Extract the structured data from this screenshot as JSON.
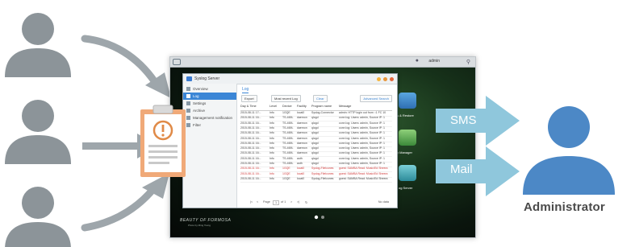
{
  "admin_label": "Administrator",
  "channels": [
    {
      "label": "SMS"
    },
    {
      "label": "Mail"
    }
  ],
  "colors": {
    "user_silhouette": "#8c9499",
    "admin_silhouette": "#4c88c6",
    "arrow_gray": "#9ea6ab",
    "arrow_blue": "#8fc7dc",
    "doc_orange": "#f0a978",
    "accent_blue": "#3b86d6"
  },
  "desktop": {
    "taskbar_user": "admin",
    "window_title": "Syslog Server",
    "sidebar": [
      {
        "label": "Overview",
        "icon": "overview-icon"
      },
      {
        "label": "Log",
        "icon": "log-icon"
      },
      {
        "label": "Settings",
        "icon": "settings-icon"
      },
      {
        "label": "Archive",
        "icon": "archive-icon"
      },
      {
        "label": "Management notification",
        "icon": "notification-icon"
      },
      {
        "label": "Filter",
        "icon": "filter-icon"
      }
    ],
    "tab": "Log",
    "toolbar": {
      "export": "Export",
      "range": "Most recent Log",
      "clear": "Clear",
      "advanced": "Advanced Search"
    },
    "columns": [
      "Day & Time",
      "Level",
      "Device",
      "Facility",
      "Program name",
      "Message"
    ],
    "rows": [
      {
        "time": "2015-08-11 17:..",
        "level": "Info",
        "device": "1GQE",
        "facility": "local0",
        "program": "Syslog-Connector",
        "message": "admin: HTTP login out from ::1 FC 10"
      },
      {
        "time": "2015-08-11 16:..",
        "level": "Info",
        "device": "TS-469L",
        "facility": "daemon",
        "program": "qlogd",
        "message": "conn log: Users: admin, Source IP: 1"
      },
      {
        "time": "2015-08-11 16:..",
        "level": "Info",
        "device": "TS-469L",
        "facility": "daemon",
        "program": "qlogd",
        "message": "conn log: Users: admin, Source IP: 1"
      },
      {
        "time": "2015-08-11 16:..",
        "level": "Info",
        "device": "TS-469L",
        "facility": "daemon",
        "program": "qlogd",
        "message": "conn log: Users: admin, Source IP: 1"
      },
      {
        "time": "2015-08-11 16:..",
        "level": "Info",
        "device": "TS-469L",
        "facility": "daemon",
        "program": "qlogd",
        "message": "conn log: Users: admin, Source IP: 1"
      },
      {
        "time": "2015-08-11 16:..",
        "level": "Info",
        "device": "TS-469L",
        "facility": "daemon",
        "program": "qlogd",
        "message": "conn log: Users: admin, Source IP: 1"
      },
      {
        "time": "2015-08-11 16:..",
        "level": "Info",
        "device": "TS-469L",
        "facility": "daemon",
        "program": "qlogd",
        "message": "conn log: Users: admin, Source IP: 1"
      },
      {
        "time": "2015-08-11 16:..",
        "level": "Info",
        "device": "TS-469L",
        "facility": "daemon",
        "program": "qlogd",
        "message": "conn log: Users: admin, Source IP: 1"
      },
      {
        "time": "2015-08-11 16:..",
        "level": "Info",
        "device": "TS-469L",
        "facility": "daemon",
        "program": "qlogd",
        "message": "conn log: Users: admin, Source IP: 1"
      },
      {
        "time": "2015-08-11 16:..",
        "level": "Info",
        "device": "TS-469L",
        "facility": "auth",
        "program": "qlogd",
        "message": "conn log: Users: admin, Source IP: 1"
      },
      {
        "time": "2015-08-11 16:..",
        "level": "Info",
        "device": "TS-469L",
        "facility": "auth",
        "program": "qlogd",
        "message": "conn log: Users: admin, Source IP: 1"
      },
      {
        "time": "2015-08-11 16:..",
        "level": "Info",
        "device": "1GQE",
        "facility": "local0",
        "program": "Syslog-Filelcones",
        "message": "guest: SAMBA Read: Music/Ed Sheera",
        "warn": true
      },
      {
        "time": "2015-08-11 16:..",
        "level": "Info",
        "device": "1GQE",
        "facility": "local0",
        "program": "Syslog-Filelcones",
        "message": "guest: SAMBA Read: Music/Ed Sheera",
        "warn": true
      },
      {
        "time": "2015-08-11 16:..",
        "level": "Info",
        "device": "1GQE",
        "facility": "local0",
        "program": "Syslog-Filelcones",
        "message": "guest: SAMBA Read: Music/Ed Sheera"
      }
    ],
    "pager": {
      "page_label": "Page",
      "page": "1",
      "of": "of 1",
      "total": "No data"
    },
    "desktop_icons": [
      {
        "label": "s & Restore"
      },
      {
        "label": "y Manager"
      },
      {
        "label": "og Server"
      }
    ],
    "brand": "BEAUTY OF FORMOSA",
    "brand_sub": "Photo by Ming Tsung"
  }
}
